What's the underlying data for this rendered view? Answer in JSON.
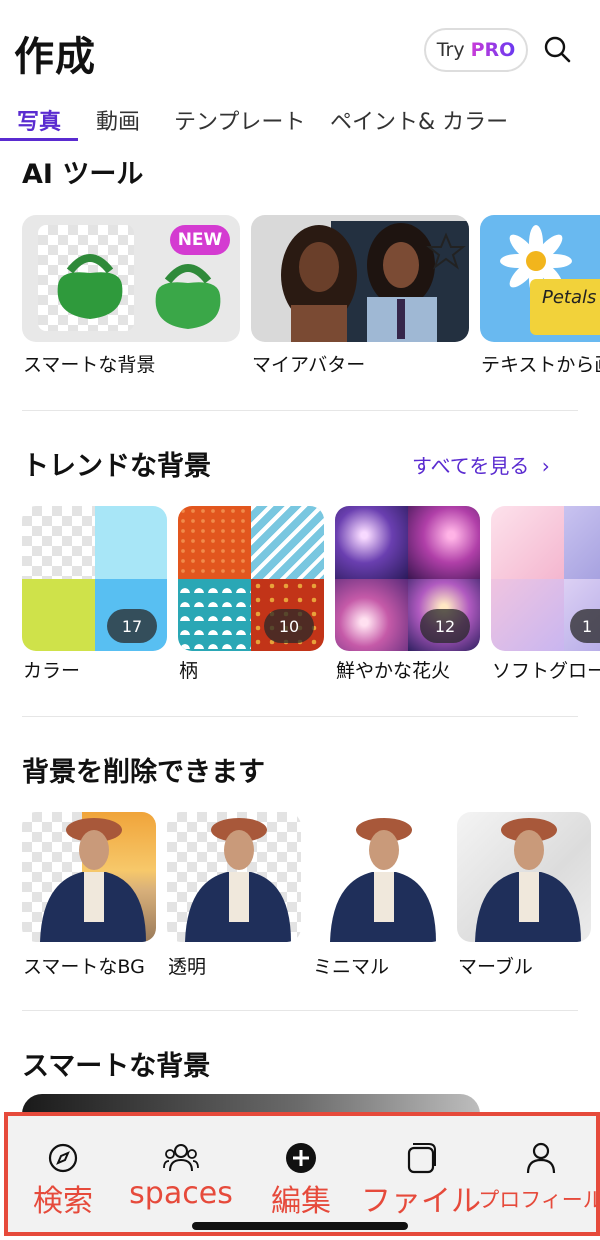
{
  "header": {
    "title": "作成",
    "try_label": "Try",
    "pro_label": "PRO"
  },
  "tabs": [
    {
      "label": "写真",
      "active": true
    },
    {
      "label": "動画",
      "active": false
    },
    {
      "label": "テンプレート",
      "active": false
    },
    {
      "label": "ペイント& カラー",
      "active": false
    }
  ],
  "ai_tools": {
    "title": "AI ツール",
    "items": [
      {
        "label": "スマートな背景",
        "badge": "NEW"
      },
      {
        "label": "マイアバター"
      },
      {
        "label": "テキストから画"
      }
    ],
    "petals_text": "Petals"
  },
  "trending": {
    "title": "トレンドな背景",
    "see_all": "すべてを見る",
    "items": [
      {
        "label": "カラー",
        "count": "17"
      },
      {
        "label": "柄",
        "count": "10"
      },
      {
        "label": "鮮やかな花火",
        "count": "12"
      },
      {
        "label": "ソフトグロー",
        "count": "1"
      }
    ]
  },
  "remove_bg": {
    "title": "背景を削除できます",
    "items": [
      {
        "label": "スマートなBG"
      },
      {
        "label": "透明"
      },
      {
        "label": "ミニマル"
      },
      {
        "label": "マーブル"
      }
    ]
  },
  "smart_bg": {
    "title": "スマートな背景"
  },
  "bottom_nav": [
    {
      "label": "検索",
      "icon": "compass-icon"
    },
    {
      "label": "spaces",
      "icon": "people-icon"
    },
    {
      "label": "編集",
      "icon": "plus-circle-icon"
    },
    {
      "label": "ファイル",
      "icon": "folder-icon"
    },
    {
      "label": "プロフィール",
      "icon": "person-icon"
    }
  ],
  "colors": {
    "accent": "#5a2bd0",
    "highlight": "#e64a3b",
    "new_badge": "#d43bd1"
  }
}
